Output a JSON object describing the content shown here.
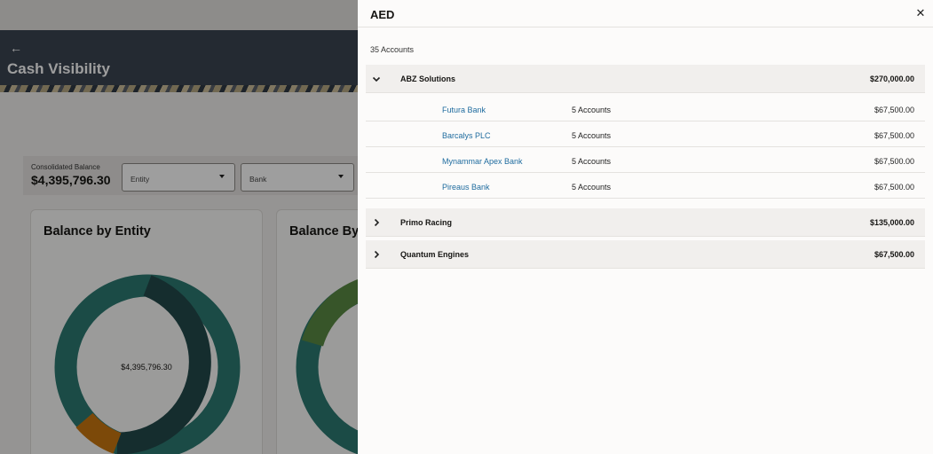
{
  "background": {
    "back_arrow": "←",
    "page_title": "Cash Visibility",
    "consolidated_label": "Consolidated Balance",
    "consolidated_value": "$4,395,796.30",
    "filters": {
      "entity_placeholder": "Entity",
      "bank_placeholder": "Bank"
    },
    "cards": [
      {
        "title": "Balance by Entity",
        "center_value": "$4,395,796.30"
      },
      {
        "title": "Balance By"
      }
    ]
  },
  "drawer": {
    "title": "AED",
    "close_glyph": "✕",
    "account_count": "35 Accounts",
    "groups": [
      {
        "name": "ABZ Solutions",
        "amount": "$270,000.00",
        "expanded": true,
        "banks": [
          {
            "name": "Futura Bank",
            "accounts": "5 Accounts",
            "amount": "$67,500.00"
          },
          {
            "name": "Barcalys PLC",
            "accounts": "5 Accounts",
            "amount": "$67,500.00"
          },
          {
            "name": "Mynammar Apex Bank",
            "accounts": "5 Accounts",
            "amount": "$67,500.00"
          },
          {
            "name": "Pireaus Bank",
            "accounts": "5 Accounts",
            "amount": "$67,500.00"
          }
        ]
      },
      {
        "name": "Primo Racing",
        "amount": "$135,000.00",
        "expanded": false
      },
      {
        "name": "Quantum Engines",
        "amount": "$67,500.00",
        "expanded": false
      }
    ]
  },
  "colors": {
    "link": "#1f6c9f",
    "header": "#3b4452",
    "donut_dark": "#234a4b",
    "donut_teal": "#2c7a72",
    "donut_orange": "#c9770f",
    "donut_green": "#5a8a43"
  }
}
